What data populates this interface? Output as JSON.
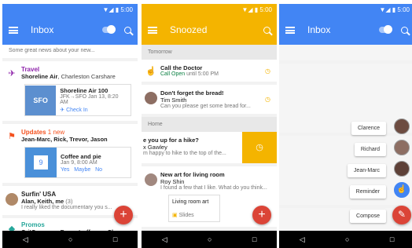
{
  "status_time": "5:00",
  "nav": {
    "back": "◁",
    "home": "○",
    "recents": "□"
  },
  "p1": {
    "title": "Inbox",
    "top_text": "Some great news about your new...",
    "travel": {
      "label": "Travel",
      "from": "Shoreline Air",
      "from_rest": ", Charleston Carshare",
      "flight": {
        "code_img": "SFO",
        "name": "Shoreline Air 100",
        "route": "JFK→SFO",
        "date": "Jan 13, 8:20 AM",
        "action": "Check In"
      }
    },
    "updates": {
      "label": "Updates",
      "badge": "1 new",
      "from": "Jean-Marc, Rick, Trevor, Jason",
      "event": {
        "day": "9",
        "name": "Coffee and pie",
        "date": "Jan 9, 8:00 AM",
        "yes": "Yes",
        "maybe": "Maybe",
        "no": "No"
      }
    },
    "surfin": {
      "sender": "Surfin' USA",
      "to": "Alan, Keith, me",
      "count": "(3)",
      "snippet": "I really liked the documentary you s..."
    },
    "promos": {
      "label": "Promos",
      "from": "CritCoupons, Boogstroff.com, Ch..."
    }
  },
  "p2": {
    "title": "Snoozed",
    "section_tomorrow": "Tomorrow",
    "call": {
      "title": "Call the Doctor",
      "call": "Call",
      "open": "Open",
      "until": "until 5:00 PM"
    },
    "bread": {
      "title": "Don't forget the bread!",
      "name": "Tim Smith",
      "snippet": "Can you please get some bread for..."
    },
    "section_home": "Home",
    "hike": {
      "title": "e you up for a hike?",
      "name": "x Gawley",
      "snippet": "m happy to hike to the top of the..."
    },
    "art": {
      "title": "New art for living room",
      "name": "Roy Shin",
      "snippet": "I found a few that I like. What do you think...",
      "attachment": "Living room art",
      "slides": "Slides"
    }
  },
  "p3": {
    "title": "Inbox",
    "menu": [
      "Clarence",
      "Richard",
      "Jean-Marc",
      "Reminder",
      "Compose"
    ]
  }
}
